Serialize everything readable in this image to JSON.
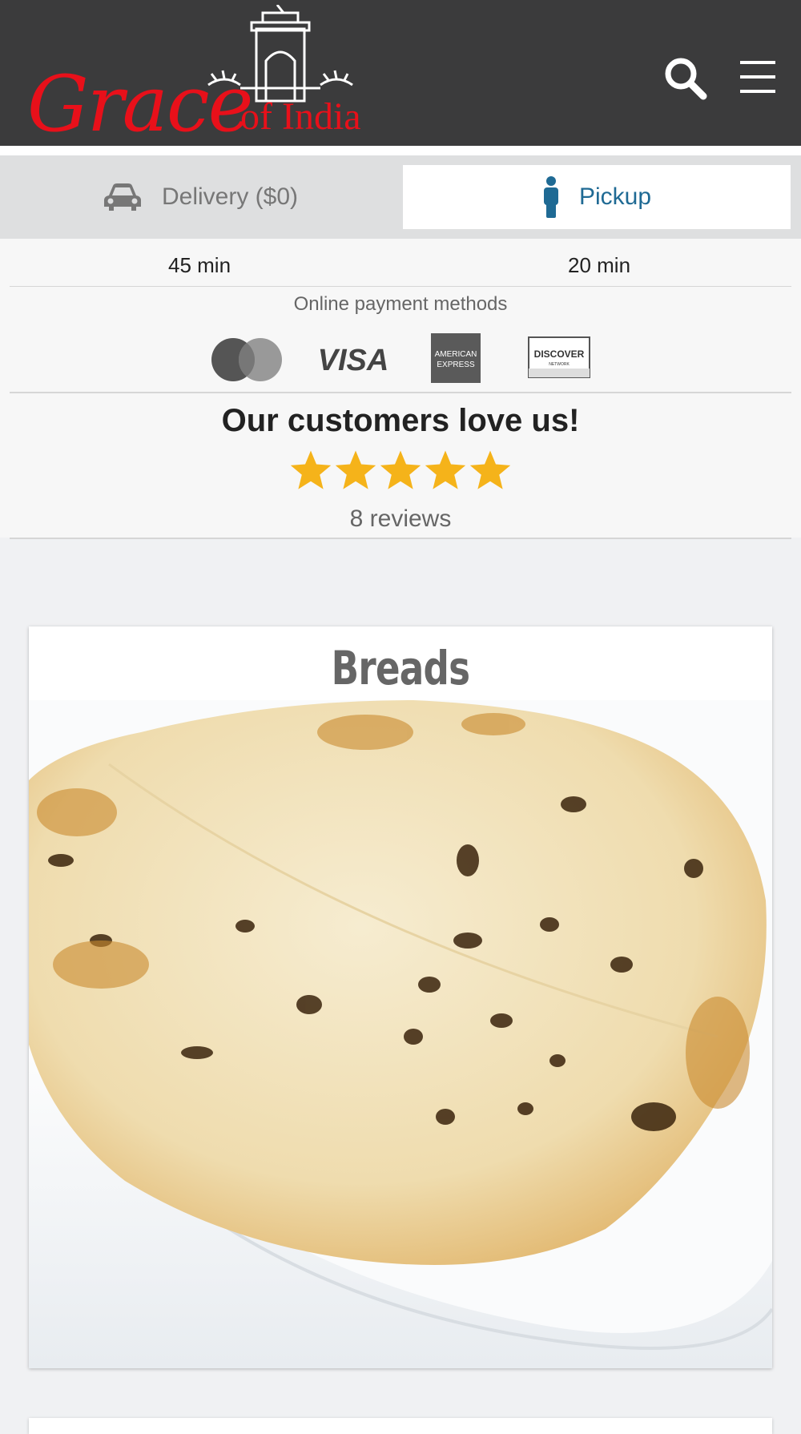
{
  "header": {
    "logo_text": "Grace of India",
    "logo_main": "Grace",
    "logo_sub": "of India"
  },
  "tabs": {
    "delivery_label": "Delivery ($0)",
    "pickup_label": "Pickup",
    "active": "pickup"
  },
  "times": {
    "delivery": "45 min",
    "pickup": "20 min"
  },
  "payment": {
    "title": "Online payment methods",
    "methods": [
      "Mastercard",
      "VISA",
      "American Express",
      "Discover"
    ],
    "visa_text": "VISA",
    "amex_line1": "AMERICAN",
    "amex_line2": "EXPRESS",
    "discover_text": "DISCOVER",
    "discover_sub": "NETWORK"
  },
  "reviews": {
    "headline": "Our customers love us!",
    "rating": 5,
    "max_rating": 5,
    "count_text": "8 reviews"
  },
  "menu": {
    "categories": [
      {
        "title": "Breads"
      }
    ]
  },
  "colors": {
    "header_bg": "#3b3b3c",
    "logo_red": "#e8101a",
    "pickup_blue": "#1f6a94",
    "star_gold": "#f5b31a"
  }
}
